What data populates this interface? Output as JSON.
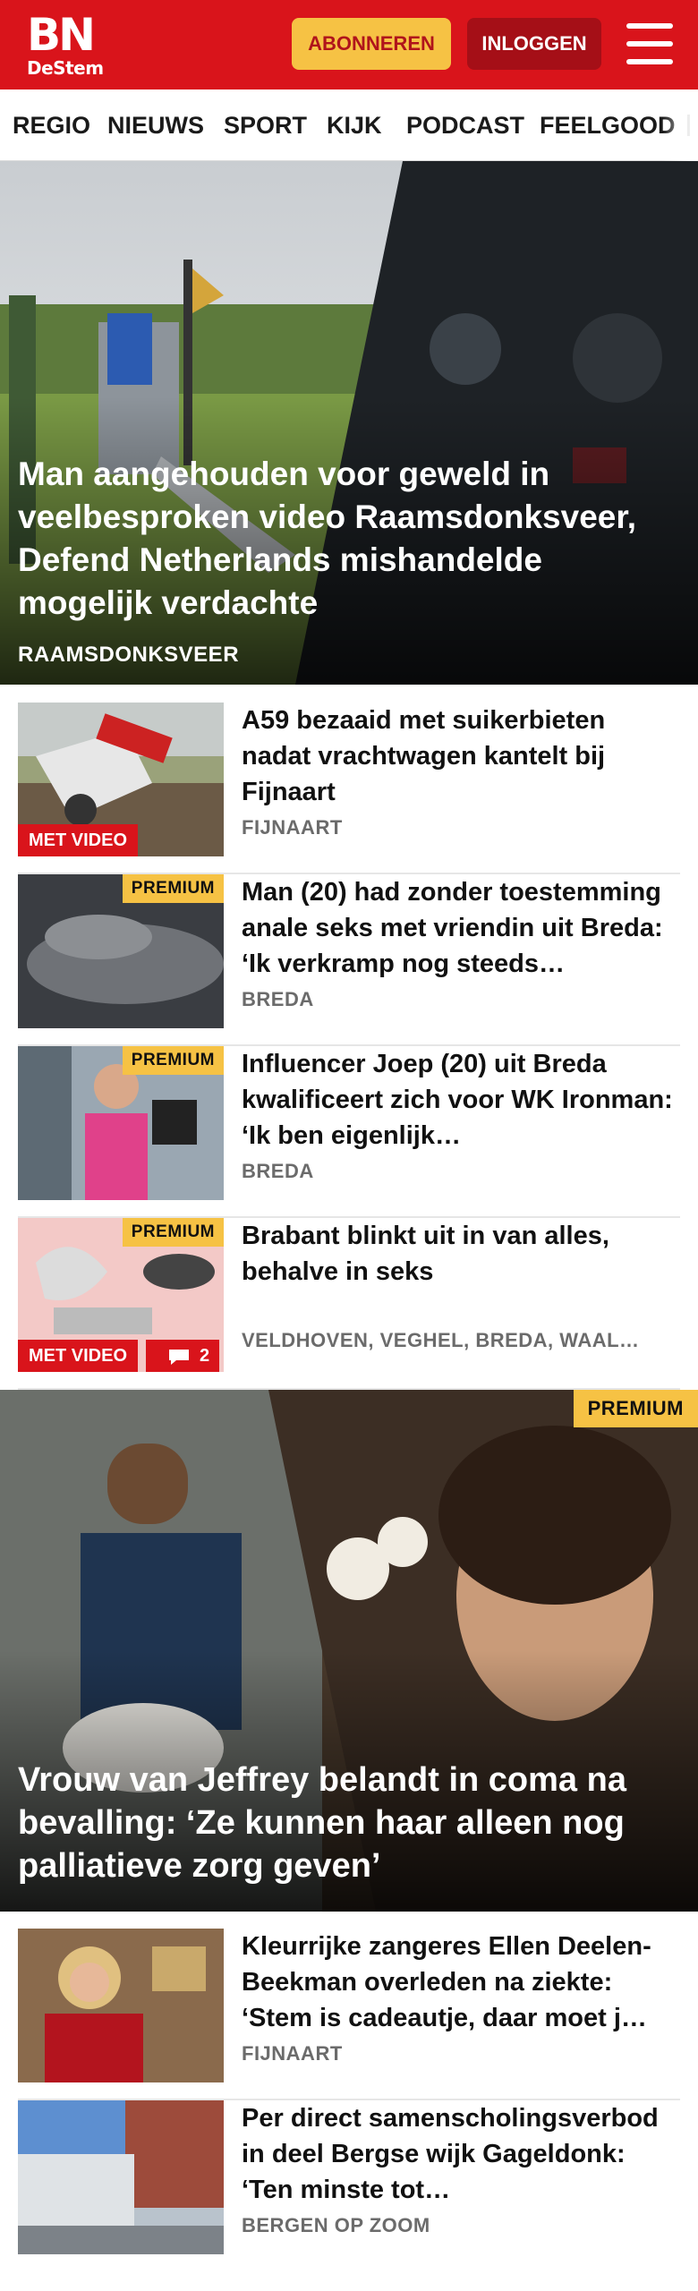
{
  "header": {
    "logo_main": "BN",
    "logo_sub": "DeStem",
    "subscribe_label": "ABONNEREN",
    "login_label": "INLOGGEN"
  },
  "nav": {
    "items": [
      "REGIO",
      "NIEUWS",
      "SPORT",
      "KIJK",
      "PODCAST",
      "FEELGOOD"
    ]
  },
  "hero": {
    "title": "Man aangehouden voor geweld in veelbesproken video Raamsdonks­veer, Defend Netherlands mishandel­de mogelijk verdachte",
    "location": "RAAMSDONKSVEER"
  },
  "articles": [
    {
      "title": "A59 bezaaid met suikerbieten nadat vrachtwagen kantelt bij Fijnaart",
      "location": "FIJNAART",
      "video_label": "MET VIDEO"
    },
    {
      "title": "Man (20) had zonder toestem­ming anale seks met vriendin uit Breda: ‘Ik verkramp nog steeds…",
      "location": "BREDA",
      "premium_label": "PREMIUM"
    },
    {
      "title": "Influencer Joep (20) uit Breda kwalificeert zich voor WK Ironman: ‘Ik ben eigenlijk…",
      "location": "BREDA",
      "premium_label": "PREMIUM"
    },
    {
      "title": "Brabant blinkt uit in van alles, behalve in seks",
      "location": "VELDHOVEN, VEGHEL, BREDA, WAAL…",
      "premium_label": "PREMIUM",
      "video_label": "MET VIDEO",
      "comment_count": "2"
    }
  ],
  "feature": {
    "premium_label": "PREMIUM",
    "title": "Vrouw van Jeffrey belandt in coma na bevalling: ‘Ze kunnen haar alleen nog palliatieve zorg geven’"
  },
  "articles2": [
    {
      "title": "Kleurrijke zangeres Ellen Deelen-Beekman overleden na ziekte: ‘Stem is cadeautje, daar moet j…",
      "location": "FIJNAART"
    },
    {
      "title": "Per direct samenscholingsver­bod in deel Bergse wijk Gageldonk: ‘Ten minste tot…",
      "location": "BERGEN OP ZOOM"
    }
  ],
  "colors": {
    "brand_red": "#d9141b",
    "premium_yellow": "#f6c244",
    "login_red": "#a50f17"
  },
  "icons": [
    "menu-icon",
    "comment-icon"
  ]
}
